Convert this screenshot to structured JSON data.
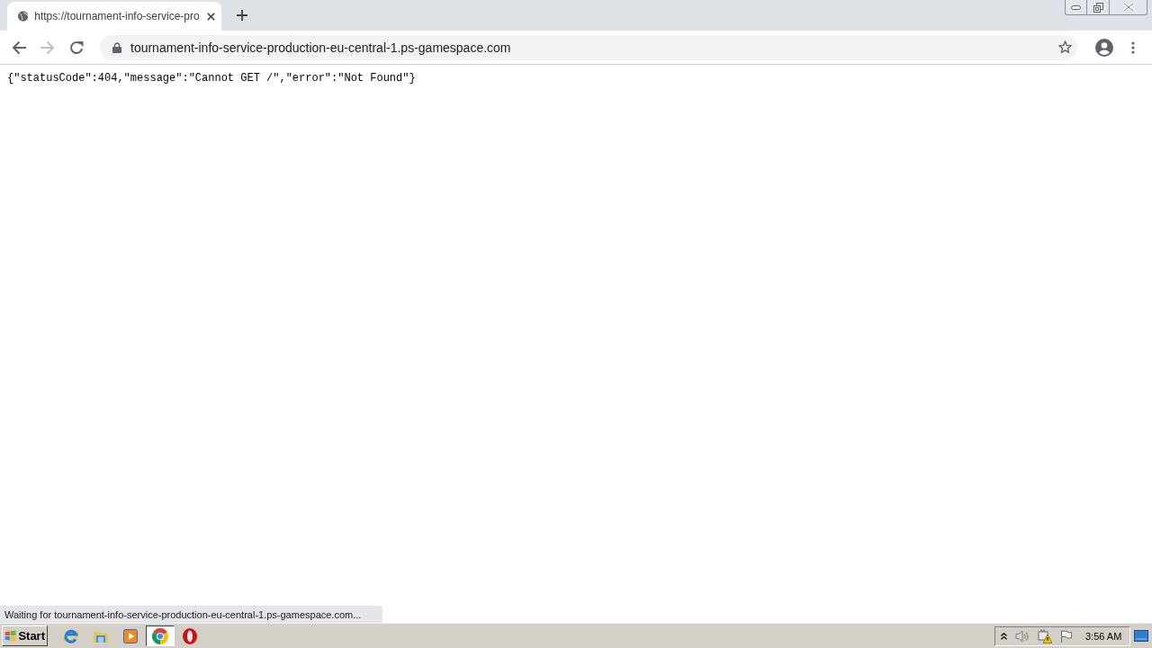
{
  "browser": {
    "tabs": [
      {
        "title": "https://tournament-info-service-pro",
        "selected": true
      }
    ],
    "toolbar": {
      "forward_disabled": true,
      "address": "tournament-info-service-production-eu-central-1.ps-gamespace.com"
    }
  },
  "page": {
    "body": "{\"statusCode\":404,\"message\":\"Cannot GET /\",\"error\":\"Not Found\"}"
  },
  "status_bubble": {
    "text": "Waiting for tournament-info-service-production-eu-central-1.ps-gamespace.com..."
  },
  "taskbar": {
    "start": "Start",
    "apps": [
      {
        "kind": "ie",
        "selected": false
      },
      {
        "kind": "explorer",
        "selected": false
      },
      {
        "kind": "media",
        "selected": false
      },
      {
        "kind": "chrome",
        "selected": true
      },
      {
        "kind": "opera",
        "selected": false
      }
    ],
    "clock": "3:56 AM"
  }
}
